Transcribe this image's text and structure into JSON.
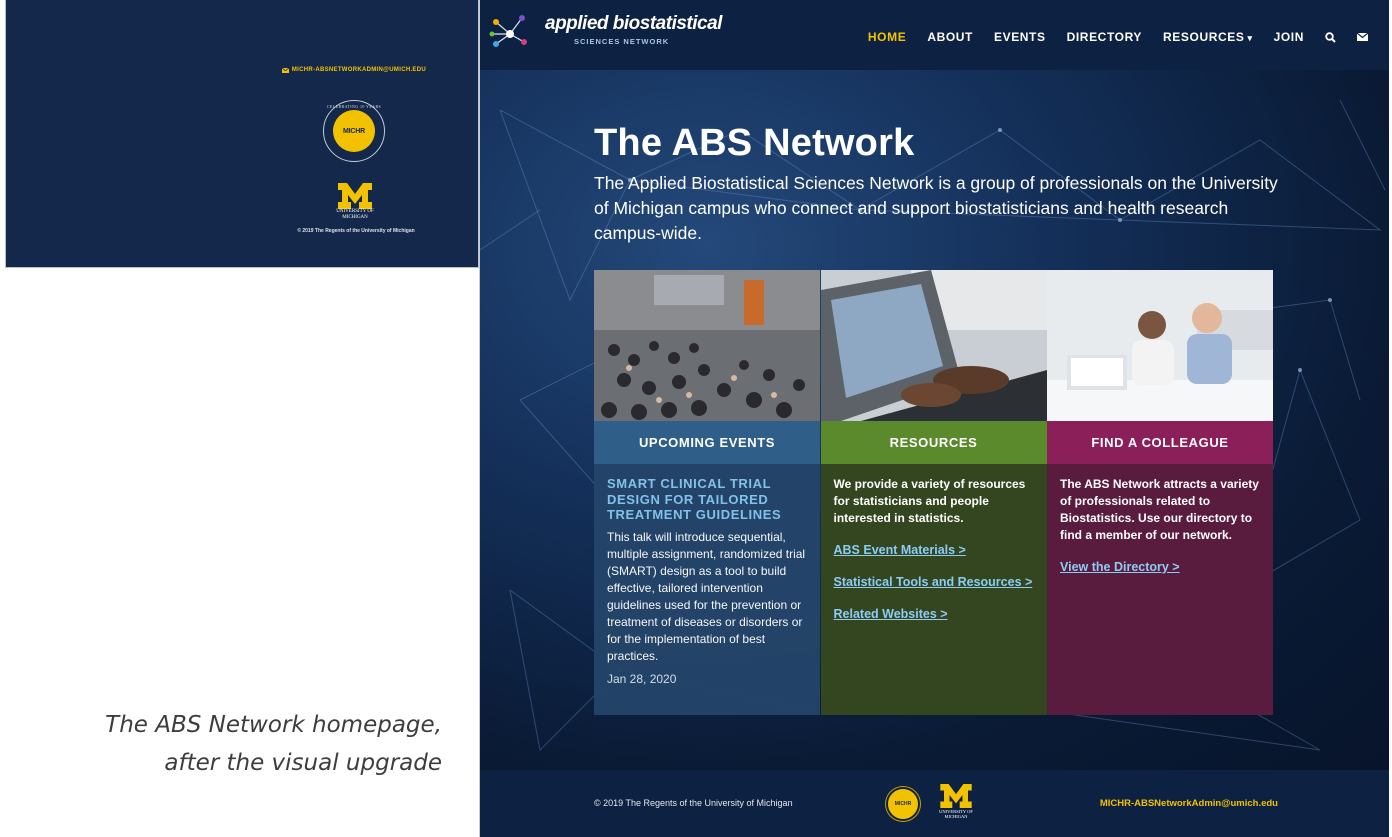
{
  "old_footer": {
    "email": "MICHR-ABSNETWORKADMIN@UMICH.EDU",
    "badge_ring_text": "CELEBRATING 10 YEARS",
    "badge_label": "MICHR",
    "umich_sub": "UNIVERSITY OF MICHIGAN",
    "copyright": "© 2019 The Regents of the University of Michigan"
  },
  "caption": {
    "line1": "The ABS Network homepage,",
    "line2": "after the visual upgrade"
  },
  "nav": {
    "logo_word": "applied biostatistical",
    "logo_sub": "SCIENCES NETWORK",
    "items": [
      {
        "label": "HOME",
        "active": true
      },
      {
        "label": "ABOUT"
      },
      {
        "label": "EVENTS"
      },
      {
        "label": "DIRECTORY"
      },
      {
        "label": "RESOURCES",
        "caret": "▾"
      },
      {
        "label": "JOIN"
      }
    ],
    "icons": [
      "search-icon",
      "envelope-icon"
    ]
  },
  "hero": {
    "title": "The ABS Network",
    "text": "The Applied Biostatistical Sciences Network is a group of professionals on the University of Michigan campus who connect and support biostatisticians and health research campus-wide."
  },
  "cards": {
    "events": {
      "heading": "UPCOMING EVENTS",
      "event_title": "SMART CLINICAL TRIAL DESIGN FOR TAILORED TREATMENT GUIDELINES",
      "event_text": "This talk will introduce sequential, multiple assignment, randomized trial (SMART) design as a tool to build effective, tailored intervention guidelines used for the prevention or treatment of diseases or disorders or for the implementation of best practices.",
      "event_date": "Jan 28, 2020",
      "color": "#2f5f88"
    },
    "resources": {
      "heading": "RESOURCES",
      "text": "We provide a variety of resources for statisticians and people interested in statistics.",
      "links": [
        "ABS Event Materials >",
        "Statistical Tools and Resources >",
        "Related Websites >"
      ],
      "color": "#5b8a2c"
    },
    "colleague": {
      "heading": "FIND A COLLEAGUE",
      "text": "The ABS Network attracts a variety of professionals related to Biostatistics. Use our directory to find a member of our network.",
      "link": "View the Directory >",
      "color": "#8b1f5a"
    }
  },
  "footer": {
    "copyright": "© 2019 The Regents of the University of Michigan",
    "michr_label": "MICHR",
    "umich_sub": "UNIVERSITY OF MICHIGAN",
    "email": "MICHR-ABSNetworkAdmin@umich.edu"
  },
  "colors": {
    "navy": "#0d2142",
    "maize": "#f2c200",
    "link": "#8ccdf5"
  }
}
